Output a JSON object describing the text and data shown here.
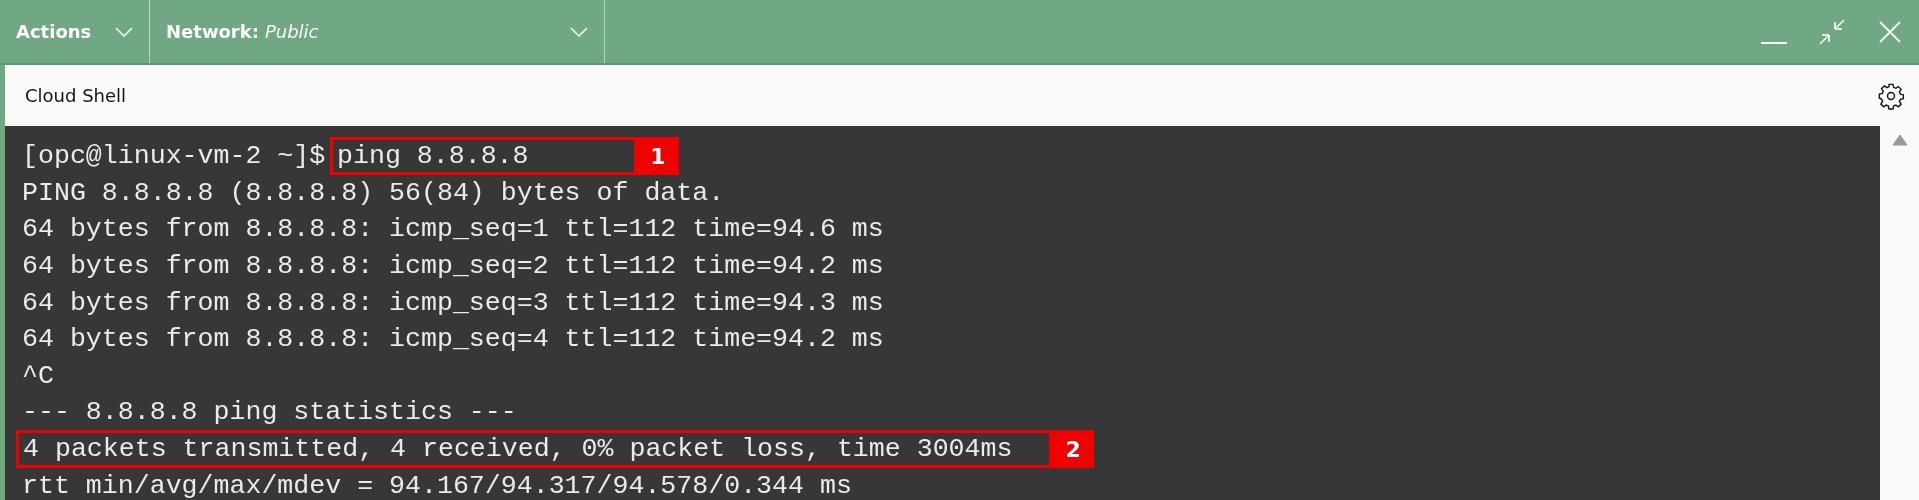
{
  "toolbar": {
    "menus": [
      {
        "label": "Actions"
      },
      {
        "label": "Network:",
        "value": "Public"
      }
    ]
  },
  "panel": {
    "title": "Cloud Shell"
  },
  "terminal": {
    "lines": [
      {
        "kind": "command",
        "prompt": "[opc@linux-vm-2 ~]$",
        "text": "ping 8.8.8.8",
        "callout": "1"
      },
      {
        "kind": "output",
        "text": "PING 8.8.8.8 (8.8.8.8) 56(84) bytes of data."
      },
      {
        "kind": "output",
        "text": "64 bytes from 8.8.8.8: icmp_seq=1 ttl=112 time=94.6 ms"
      },
      {
        "kind": "output",
        "text": "64 bytes from 8.8.8.8: icmp_seq=2 ttl=112 time=94.2 ms"
      },
      {
        "kind": "output",
        "text": "64 bytes from 8.8.8.8: icmp_seq=3 ttl=112 time=94.3 ms"
      },
      {
        "kind": "output",
        "text": "64 bytes from 8.8.8.8: icmp_seq=4 ttl=112 time=94.2 ms"
      },
      {
        "kind": "output",
        "text": "^C"
      },
      {
        "kind": "output",
        "text": "--- 8.8.8.8 ping statistics ---"
      },
      {
        "kind": "output",
        "text": "4 packets transmitted, 4 received, 0% packet loss, time 3004ms",
        "callout": "2"
      },
      {
        "kind": "output",
        "text": "rtt min/avg/max/mdev = 94.167/94.317/94.578/0.344 ms"
      }
    ]
  }
}
